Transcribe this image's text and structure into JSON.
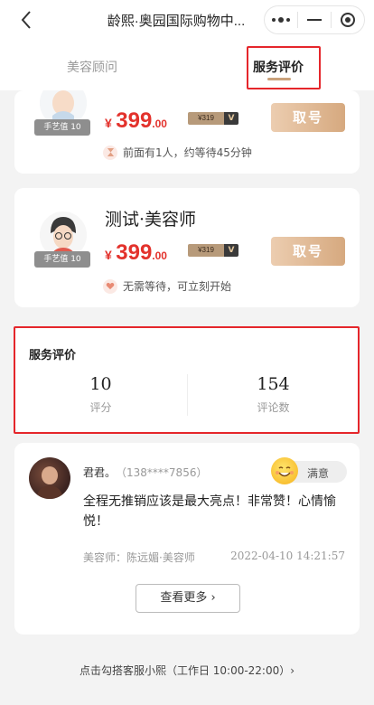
{
  "header": {
    "title": "龄熙·奥园国际购物中..."
  },
  "tabs": [
    {
      "label": "美容顾问"
    },
    {
      "label": "服务评价"
    }
  ],
  "staff_cards": [
    {
      "name": "",
      "level": "手艺值 10",
      "price_currency": "¥",
      "price_int": "399",
      "price_dec": ".00",
      "vip_price": "¥319",
      "vip_tag": "V",
      "button": "取号",
      "wait_text": "前面有1人，约等待45分钟"
    },
    {
      "name": "测试·美容师",
      "level": "手艺值 10",
      "price_currency": "¥",
      "price_int": "399",
      "price_dec": ".00",
      "vip_price": "¥319",
      "vip_tag": "V",
      "button": "取号",
      "wait_text": "无需等待，可立刻开始"
    }
  ],
  "service_rating": {
    "title": "服务评价",
    "score": "10",
    "score_label": "评分",
    "comment_count": "154",
    "comment_label": "评论数"
  },
  "review": {
    "user": "君君。",
    "phone": "（138****7856）",
    "badge": "满意",
    "text": "全程无推销应该是最大亮点！非常赞！心情愉悦！",
    "staff": "美容师：陈远媚·美容师",
    "time": "2022-04-10 14:21:57",
    "more": "查看更多 ›"
  },
  "footer": {
    "text": "点击勾搭客服小熙（工作日 10:00-22:00）›"
  },
  "colors": {
    "price": "#e3322c",
    "accent": "#d6a97f",
    "highlight": "#e5262b"
  }
}
